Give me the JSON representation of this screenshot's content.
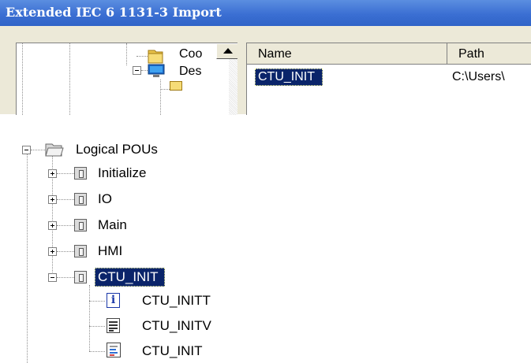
{
  "dialog": {
    "title": "Extended IEC 6 1131-3 Import",
    "folder_tree": {
      "items": [
        {
          "label": "Coo",
          "icon": "folder-icon"
        },
        {
          "label": "Des",
          "icon": "desktop-icon"
        }
      ]
    },
    "file_list": {
      "columns": [
        "Name",
        "Path"
      ],
      "rows": [
        {
          "name": "CTU_INIT",
          "path": "C:\\Users\\",
          "selected": true
        }
      ]
    }
  },
  "pou_tree": {
    "root": {
      "label": "Logical POUs",
      "icon": "open-folder-icon"
    },
    "items": [
      {
        "label": "Initialize",
        "icon": "pou-icon",
        "expanded": false
      },
      {
        "label": "IO",
        "icon": "pou-icon",
        "expanded": false
      },
      {
        "label": "Main",
        "icon": "pou-icon",
        "expanded": false
      },
      {
        "label": "HMI",
        "icon": "pou-icon",
        "expanded": false
      },
      {
        "label": "CTU_INIT",
        "icon": "pou-icon",
        "expanded": true,
        "selected": true
      }
    ],
    "children": [
      {
        "label": "CTU_INITT",
        "icon": "info-icon"
      },
      {
        "label": "CTU_INITV",
        "icon": "variables-icon"
      },
      {
        "label": "CTU_INIT",
        "icon": "code-worksheet-icon"
      }
    ]
  },
  "colors": {
    "titlebar": "#3b6fd3",
    "selection": "#0a246a",
    "dialog_bg": "#ece9d8"
  }
}
